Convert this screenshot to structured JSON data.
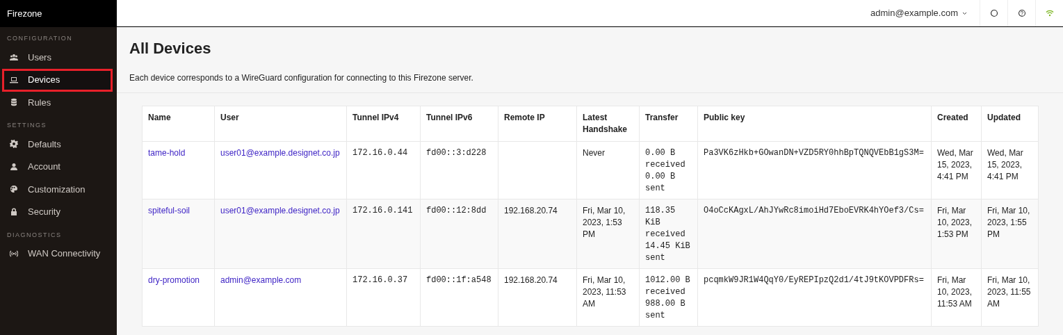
{
  "brand": "Firezone",
  "sidebar": [
    {
      "heading": "CONFIGURATION",
      "items": [
        {
          "label": "Users",
          "kind": "users",
          "selected": false
        },
        {
          "label": "Devices",
          "kind": "laptop",
          "selected": true
        },
        {
          "label": "Rules",
          "kind": "database",
          "selected": false
        }
      ]
    },
    {
      "heading": "SETTINGS",
      "items": [
        {
          "label": "Defaults",
          "kind": "gear",
          "selected": false
        },
        {
          "label": "Account",
          "kind": "user",
          "selected": false
        },
        {
          "label": "Customization",
          "kind": "palette",
          "selected": false
        },
        {
          "label": "Security",
          "kind": "lock",
          "selected": false
        }
      ]
    },
    {
      "heading": "DIAGNOSTICS",
      "items": [
        {
          "label": "WAN Connectivity",
          "kind": "signal",
          "selected": false
        }
      ]
    }
  ],
  "topbar": {
    "user_menu": "admin@example.com"
  },
  "page": {
    "title": "All Devices",
    "description": "Each device corresponds to a WireGuard configuration for connecting to this Firezone server."
  },
  "table": {
    "columns": [
      "Name",
      "User",
      "Tunnel IPv4",
      "Tunnel IPv6",
      "Remote IP",
      "Latest Handshake",
      "Transfer",
      "Public key",
      "Created",
      "Updated"
    ],
    "rows": [
      {
        "name": "tame-hold",
        "user": "user01@example.designet.co.jp",
        "tunnel_ipv4": "172.16.0.44",
        "tunnel_ipv6": "fd00::3:d228",
        "remote_ip": "",
        "latest_handshake": "Never",
        "transfer": "0.00 B received 0.00 B sent",
        "public_key": "Pa3VK6zHkb+GOwanDN+VZD5RY0hhBpTQNQVEbB1gS3M=",
        "created": "Wed, Mar 15, 2023, 4:41 PM",
        "updated": "Wed, Mar 15, 2023, 4:41 PM"
      },
      {
        "name": "spiteful-soil",
        "user": "user01@example.designet.co.jp",
        "tunnel_ipv4": "172.16.0.141",
        "tunnel_ipv6": "fd00::12:8dd",
        "remote_ip": "192.168.20.74",
        "latest_handshake": "Fri, Mar 10, 2023, 1:53 PM",
        "transfer": "118.35 KiB received 14.45 KiB sent",
        "public_key": "O4oCcKAgxL/AhJYwRc8imoiHd7EboEVRK4hYOef3/Cs=",
        "created": "Fri, Mar 10, 2023, 1:53 PM",
        "updated": "Fri, Mar 10, 2023, 1:55 PM"
      },
      {
        "name": "dry-promotion",
        "user": "admin@example.com",
        "tunnel_ipv4": "172.16.0.37",
        "tunnel_ipv6": "fd00::1f:a548",
        "remote_ip": "192.168.20.74",
        "latest_handshake": "Fri, Mar 10, 2023, 11:53 AM",
        "transfer": "1012.00 B received 988.00 B sent",
        "public_key": "pcqmkW9JR1W4QqY0/EyREPIpzQ2d1/4tJ9tKOVPDFRs=",
        "created": "Fri, Mar 10, 2023, 11:53 AM",
        "updated": "Fri, Mar 10, 2023, 11:55 AM"
      }
    ]
  }
}
